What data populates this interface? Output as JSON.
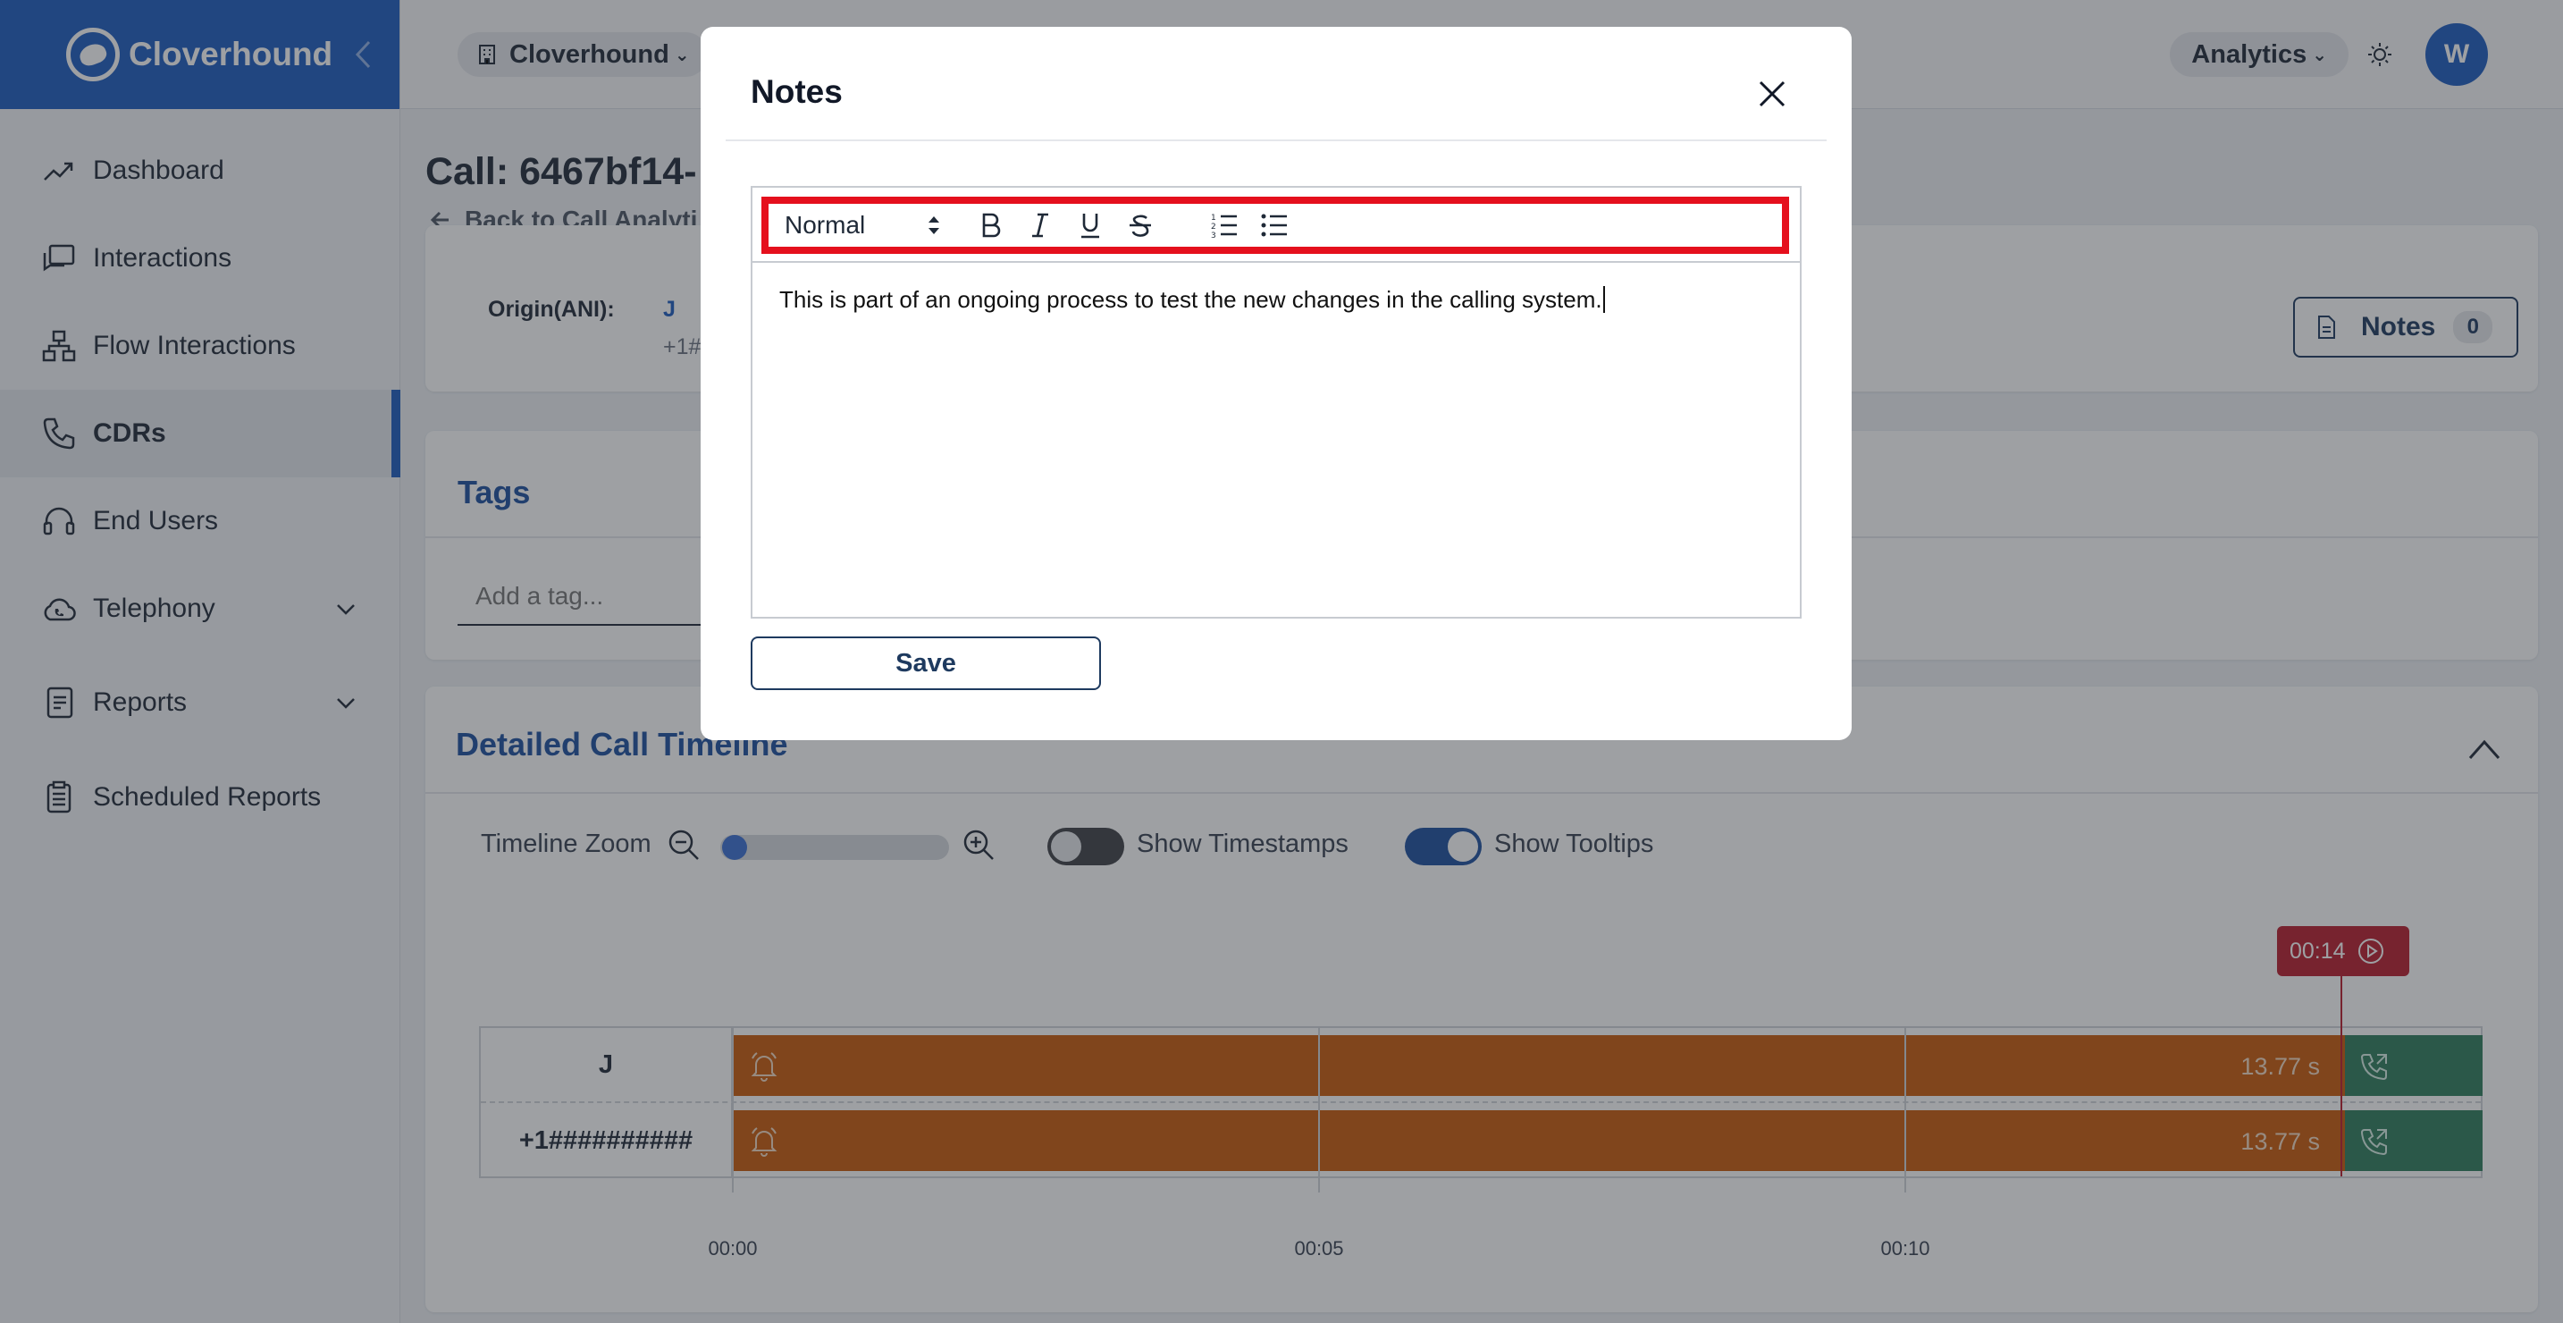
{
  "brand": {
    "name": "Cloverhound"
  },
  "sidebar": {
    "items": [
      {
        "label": "Dashboard"
      },
      {
        "label": "Interactions"
      },
      {
        "label": "Flow Interactions"
      },
      {
        "label": "CDRs"
      },
      {
        "label": "End Users"
      },
      {
        "label": "Telephony"
      },
      {
        "label": "Reports"
      },
      {
        "label": "Scheduled Reports"
      }
    ],
    "active": "CDRs"
  },
  "topbar": {
    "org": "Cloverhound",
    "analytics": "Analytics",
    "user_initial": "W"
  },
  "main": {
    "call_title": "Call: 6467bf14-",
    "back_link": "Back to Call Analyti",
    "origin_label": "Origin(ANI):",
    "origin_name": "J",
    "origin_number": "+1###",
    "notes_label": "Notes",
    "notes_count": "0"
  },
  "tags": {
    "title": "Tags",
    "placeholder": "Add a tag..."
  },
  "timeline": {
    "title": "Detailed Call Timeline",
    "zoom_label": "Timeline Zoom",
    "show_timestamps": "Show Timestamps",
    "show_tooltips": "Show Tooltips",
    "marker": "00:14",
    "rows": [
      {
        "label": "J",
        "duration": "13.77 s"
      },
      {
        "label": "+1##########",
        "duration": "13.77 s"
      }
    ],
    "ticks": [
      "00:00",
      "00:05",
      "00:10"
    ]
  },
  "modal": {
    "title": "Notes",
    "format_select": "Normal",
    "editor_text": "This is part of an ongoing process to test the new changes in the calling system.",
    "save_label": "Save"
  },
  "colors": {
    "brand": "#1d5bbf",
    "highlight": "#e5101d",
    "timeline_bar": "#c85a0a",
    "timeline_end": "#2e7d5b",
    "marker": "#b91c2c"
  }
}
